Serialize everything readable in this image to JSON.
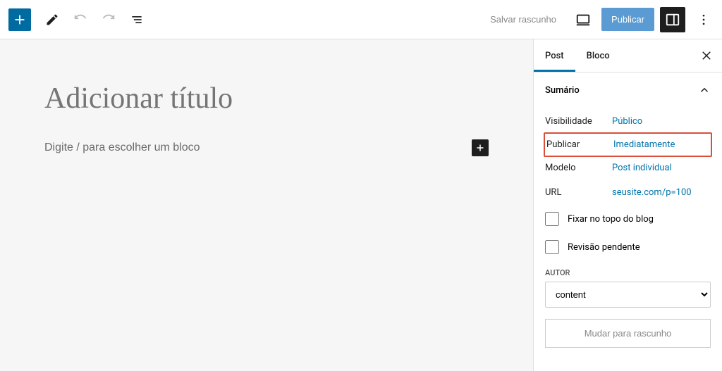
{
  "toolbar": {
    "save_draft": "Salvar rascunho",
    "publish": "Publicar"
  },
  "editor": {
    "title_placeholder": "Adicionar título",
    "block_prompt": "Digite / para escolher um bloco"
  },
  "sidebar": {
    "tabs": {
      "post": "Post",
      "block": "Bloco"
    },
    "summary_title": "Sumário",
    "rows": {
      "visibility": {
        "label": "Visibilidade",
        "value": "Público"
      },
      "publish": {
        "label": "Publicar",
        "value": "Imediatamente"
      },
      "template": {
        "label": "Modelo",
        "value": "Post individual"
      },
      "url": {
        "label": "URL",
        "value": "seusite.com/p=100"
      }
    },
    "pin_top": "Fixar no topo do blog",
    "pending_review": "Revisão pendente",
    "author_label": "Autor",
    "author_value": "content",
    "switch_draft": "Mudar para rascunho"
  }
}
